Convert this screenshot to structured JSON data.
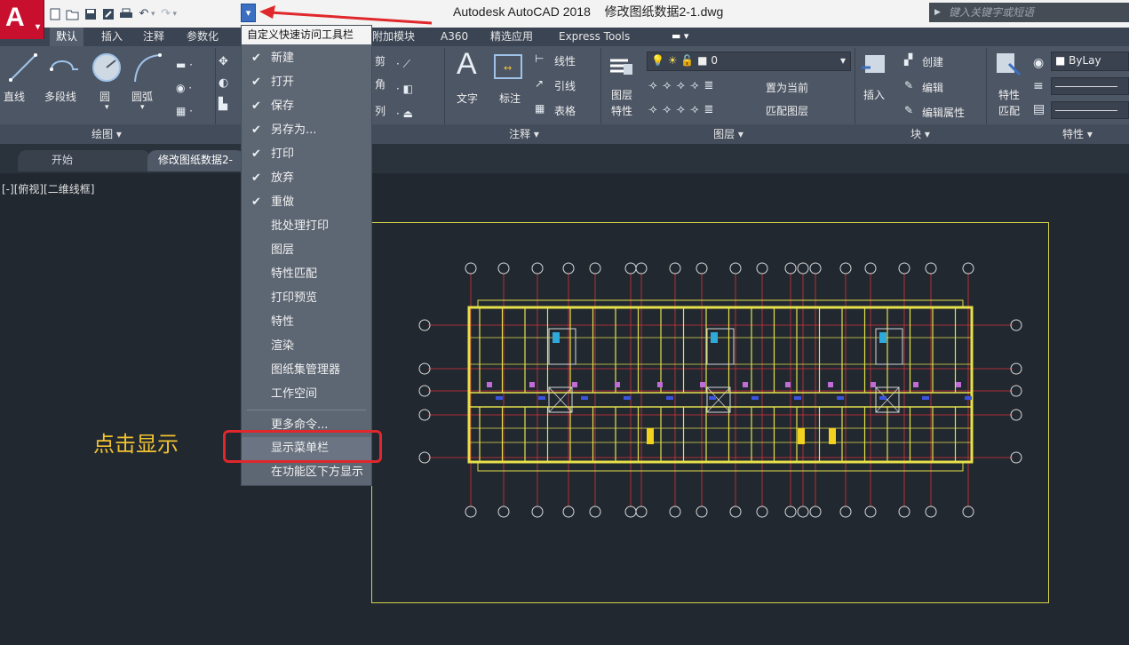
{
  "app": {
    "logo_letter": "A",
    "title": "Autodesk AutoCAD 2018    修改图纸数据2-1.dwg",
    "search_placeholder": "键入关键字或短语"
  },
  "qat": {
    "icons": [
      "new-icon",
      "open-icon",
      "save-icon",
      "saveas-icon",
      "print-icon",
      "undo-icon",
      "redo-icon"
    ],
    "dropdown_glyph": "▾"
  },
  "ribbon_tabs": [
    {
      "label": "默认",
      "active": true
    },
    {
      "label": "插入"
    },
    {
      "label": "注释"
    },
    {
      "label": "参数化"
    },
    {
      "label": "附加模块"
    },
    {
      "label": "A360"
    },
    {
      "label": "精选应用"
    },
    {
      "label": "Express Tools"
    }
  ],
  "ribbon": {
    "draw": {
      "line": "直线",
      "polyline": "多段线",
      "circle": "圆",
      "arc": "圆弧",
      "panel": "绘图 ▾"
    },
    "modify_partial": {
      "trim": "剪",
      "fillet": "角",
      "array": "列"
    },
    "annotation": {
      "text": "文字",
      "dim": "标注",
      "linetype": "线性",
      "leader": "引线",
      "table": "表格",
      "panel": "注释 ▾"
    },
    "layers": {
      "props_1": "图层",
      "props_2": "特性",
      "current": "0",
      "make_current": "置为当前",
      "match": "匹配图层",
      "panel": "图层 ▾"
    },
    "block": {
      "insert": "插入",
      "create": "创建",
      "edit": "编辑",
      "edit_attr": "编辑属性",
      "panel": "块 ▾"
    },
    "properties": {
      "match_1": "特性",
      "match_2": "匹配",
      "bylayer": "ByLay",
      "panel": "特性 ▾"
    }
  },
  "doc_tabs": [
    {
      "label": "开始"
    },
    {
      "label": "修改图纸数据2-",
      "active": true
    }
  ],
  "viewport_label": "[-][俯视][二维线框]",
  "menu": {
    "header": "自定义快速访问工具栏",
    "items": [
      {
        "label": "新建",
        "checked": true
      },
      {
        "label": "打开",
        "checked": true
      },
      {
        "label": "保存",
        "checked": true
      },
      {
        "label": "另存为...",
        "checked": true
      },
      {
        "label": "打印",
        "checked": true
      },
      {
        "label": "放弃",
        "checked": true
      },
      {
        "label": "重做",
        "checked": true
      },
      {
        "label": "批处理打印",
        "checked": false
      },
      {
        "label": "图层",
        "checked": false
      },
      {
        "label": "特性匹配",
        "checked": false
      },
      {
        "label": "打印预览",
        "checked": false
      },
      {
        "label": "特性",
        "checked": false
      },
      {
        "label": "渲染",
        "checked": false
      },
      {
        "label": "图纸集管理器",
        "checked": false
      },
      {
        "label": "工作空间",
        "checked": false
      }
    ],
    "more": "更多命令...",
    "show_menubar": "显示菜单栏",
    "show_below": "在功能区下方显示",
    "check_glyph": "✔"
  },
  "annotation": {
    "text": "点击显示",
    "color": "#f2c230",
    "box_color": "#e0272b"
  },
  "colors": {
    "accent": "#3a6fc1",
    "ribbon": "#4d5665",
    "canvas": "#212830",
    "plan_lines": "#e6e14a"
  }
}
